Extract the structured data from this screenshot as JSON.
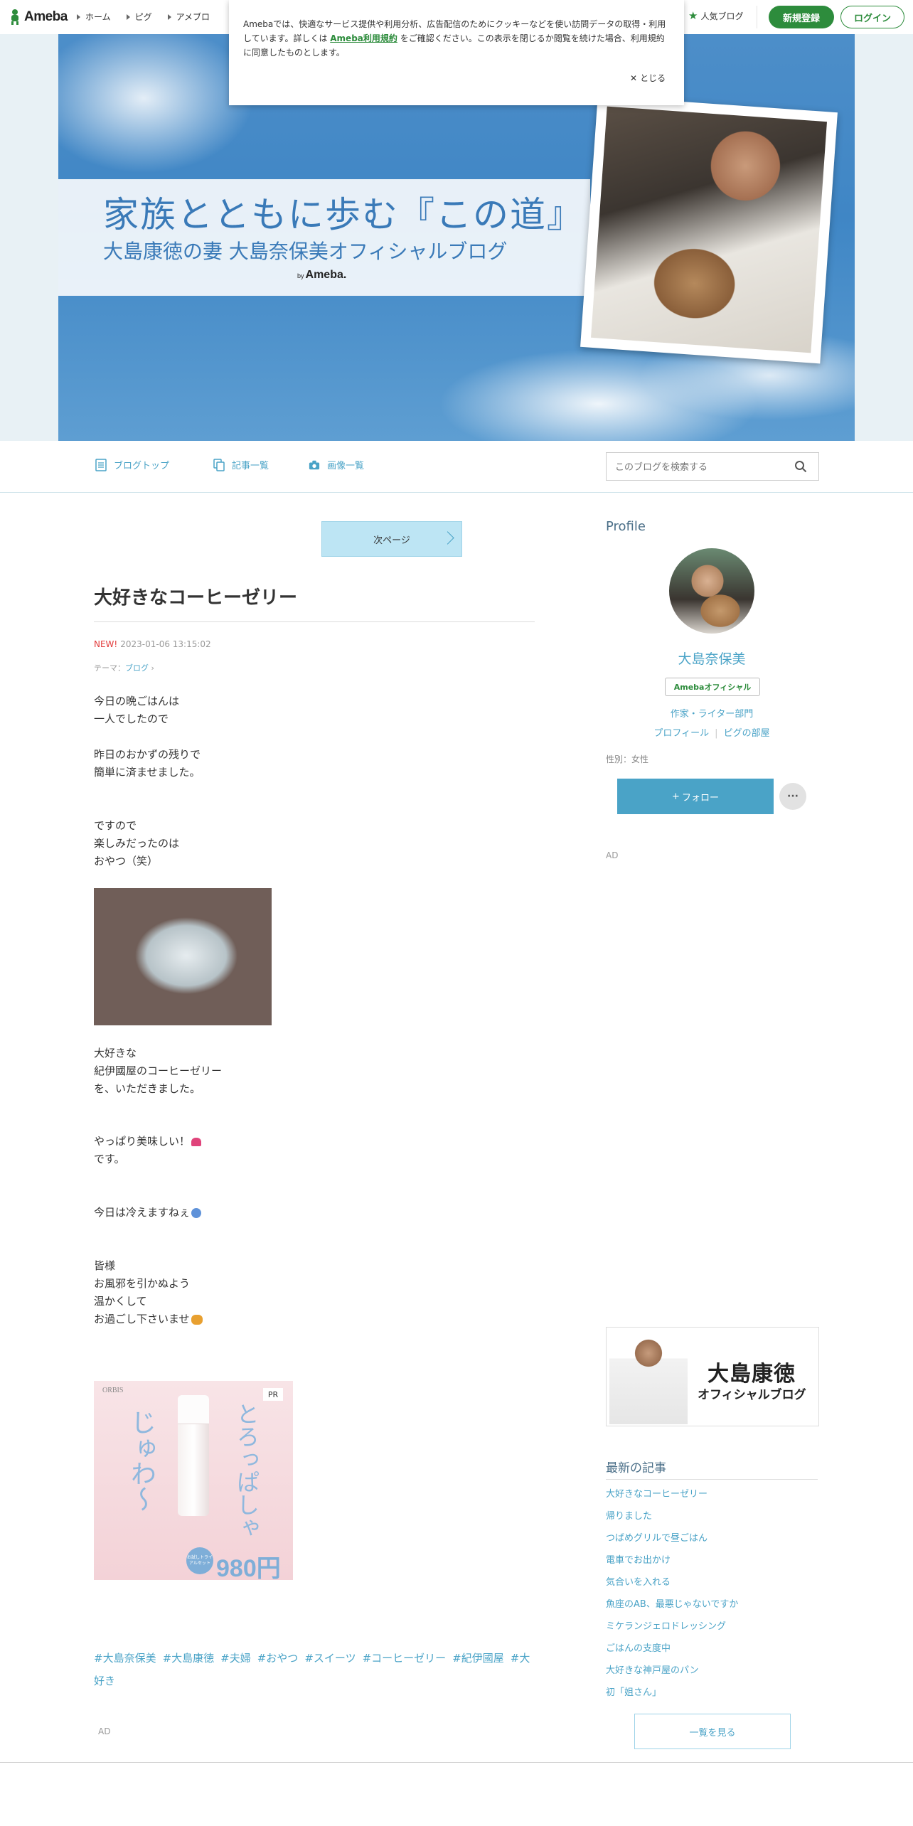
{
  "topbar": {
    "logo": "Ameba",
    "breadcrumbs": [
      "ホーム",
      "ピグ",
      "アメブロ"
    ],
    "popular_blogs": "人気ブログ",
    "register": "新規登録",
    "login": "ログイン"
  },
  "cookie_banner": {
    "text_before": "Amebaでは、快適なサービス提供や利用分析、広告配信のためにクッキーなどを使い訪問データの取得・利用しています。詳しくは ",
    "link": "Ameba利用規約",
    "text_after": " をご確認ください。この表示を閉じるか閲覧を続けた場合、利用規約に同意したものとします。",
    "close": "とじる"
  },
  "header": {
    "title": "家族とともに歩む『この道』",
    "subtitle": "大島康徳の妻 大島奈保美オフィシャルブログ",
    "by": "by",
    "brand": "Ameba."
  },
  "nav": {
    "top": "ブログトップ",
    "articles": "記事一覧",
    "images": "画像一覧",
    "search_placeholder": "このブログを検索する"
  },
  "post": {
    "next_page": "次ページ",
    "title": "大好きなコーヒーゼリー",
    "new_label": "NEW!",
    "datetime": "2023-01-06 13:15:02",
    "theme_label": "テーマ：",
    "theme": "ブログ",
    "p1": "今日の晩ごはんは\n一人でしたので",
    "p2": "昨日のおかずの残りで\n簡単に済ませました。",
    "p3": "ですので\n楽しみだったのは\nおやつ（笑）",
    "p4": "大好きな\n紀伊國屋のコーヒーゼリー\nを、いただきました。",
    "p5a": "やっぱり美味しい！",
    "p5b": "です。",
    "p6": "今日は冷えますねぇ",
    "p7": "皆様\nお風邪を引かぬよう\n温かくして\nお過ごし下さいませ",
    "hashtags": [
      "#大島奈保美",
      "#大島康徳",
      "#夫婦",
      "#おやつ",
      "#スイーツ",
      "#コーヒーゼリー",
      "#紀伊國屋",
      "#大好き"
    ],
    "ad_label": "AD"
  },
  "ad_image": {
    "brand": "ORBIS",
    "pr": "PR",
    "text_left": "じゅわ〜",
    "text_right": "とろっぱしゃ",
    "price": "980円",
    "badge": "お試しトライアルセット"
  },
  "sidebar": {
    "profile_heading": "Profile",
    "name": "大島奈保美",
    "badge": "Amebaオフィシャル",
    "category": "作家・ライター部門",
    "link_profile": "プロフィール",
    "link_pig": "ピグの部屋",
    "gender": "性別：女性",
    "follow": "フォロー",
    "follow_plus": "+",
    "more": "···",
    "ad_label": "AD",
    "banner_name": "大島康徳",
    "banner_sub": "オフィシャルブログ",
    "recent_heading": "最新の記事",
    "recent": [
      "大好きなコーヒーゼリー",
      "帰りました",
      "つばめグリルで昼ごはん",
      "電車でお出かけ",
      "気合いを入れる",
      "魚座のAB、最悪じゃないですか",
      "ミケランジェロドレッシング",
      "ごはんの支度中",
      "大好きな神戸屋のパン",
      "初「姐さん」"
    ],
    "see_all": "一覧を見る"
  },
  "colors": {
    "ameba_green": "#2d8c3c",
    "link_blue": "#4aa3c7",
    "title_blue": "#3a7ab8",
    "new_red": "#e23b3b"
  }
}
